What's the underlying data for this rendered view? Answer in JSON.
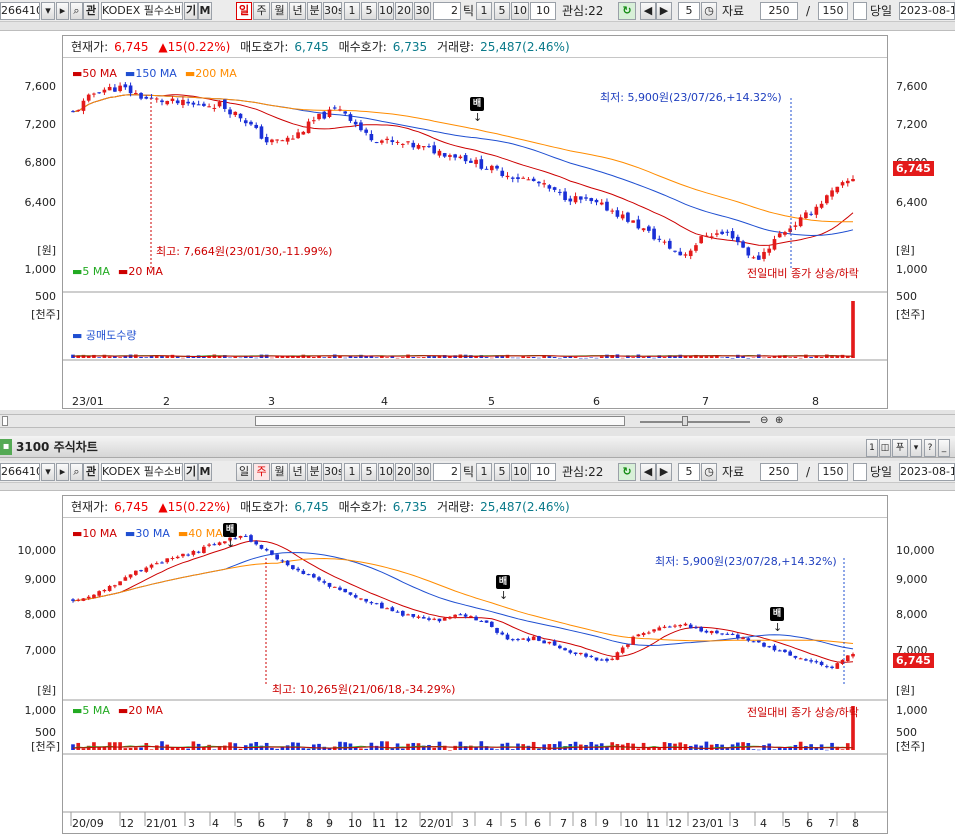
{
  "toolbar": {
    "code": "266410",
    "name": "KODEX 필수소비",
    "btn_gi": "기",
    "btn_m": "M",
    "periods": [
      "일",
      "주",
      "월",
      "년",
      "분",
      "30s",
      "1",
      "5",
      "10",
      "20",
      "30"
    ],
    "tick_value": "2",
    "tick_label": "틱",
    "ticks": [
      "1",
      "5",
      "10"
    ],
    "tick_input": "10",
    "watch_label": "관심:22",
    "count_input": "5",
    "data_label": "자료",
    "data_value": "250",
    "slash": "/",
    "max_value": "150",
    "today_label": "당일",
    "date": "2023-08-1"
  },
  "info": {
    "current_label": "현재가:",
    "current_value": "6,745",
    "change": "▲15(0.22%)",
    "ask_label": "매도호가:",
    "ask_value": "6,745",
    "bid_label": "매수호가:",
    "bid_value": "6,735",
    "vol_label": "거래량:",
    "vol_value": "25,487(2.46%)"
  },
  "chart1": {
    "legend": [
      {
        "label": "50 MA",
        "color": "#cc0000"
      },
      {
        "label": "150 MA",
        "color": "#1f4fd1"
      },
      {
        "label": "200 MA",
        "color": "#ff8c00"
      }
    ],
    "price_ticks": [
      "7,600",
      "7,200",
      "6,800",
      "6,400"
    ],
    "unit_left": "[원]",
    "unit_right": "[원]",
    "current_box": "6,745",
    "low_note": "최저: 5,900원(23/07/26,+14.32%)",
    "high_note": "최고: 7,664원(23/01/30,-11.99%)",
    "signal": "배",
    "vol_legend": [
      {
        "label": "5 MA",
        "color": "#22aa22"
      },
      {
        "label": "20 MA",
        "color": "#cc0000"
      }
    ],
    "vol_note": "전일대비 종가 상승/하락",
    "vol_ticks": [
      "1,000",
      "500"
    ],
    "vol_unit": "[천주]",
    "short_legend": "공매도수량",
    "x_labels": [
      "23/01",
      "2",
      "3",
      "4",
      "5",
      "6",
      "7",
      "8"
    ]
  },
  "chart2_title": "3100 주식차트",
  "chart2": {
    "legend": [
      {
        "label": "10 MA",
        "color": "#cc0000"
      },
      {
        "label": "30 MA",
        "color": "#1f4fd1"
      },
      {
        "label": "40 MA",
        "color": "#ff8c00"
      }
    ],
    "price_ticks": [
      "10,000",
      "9,000",
      "8,000",
      "7,000"
    ],
    "unit_left": "[원]",
    "unit_right": "[원]",
    "current_box": "6,745",
    "low_note": "최저: 5,900원(23/07/28,+14.32%)",
    "high_note": "최고: 10,265원(21/06/18,-34.29%)",
    "signal": "배",
    "vol_legend": [
      {
        "label": "5 MA",
        "color": "#22aa22"
      },
      {
        "label": "20 MA",
        "color": "#cc0000"
      }
    ],
    "vol_note": "전일대비 종가 상승/하락",
    "vol_ticks": [
      "1,000",
      "500"
    ],
    "vol_unit": "[천주]",
    "x_labels": [
      "20/09",
      "12",
      "21/01",
      "3",
      "4",
      "5",
      "6",
      "7",
      "8",
      "9",
      "10",
      "11",
      "12",
      "22/01",
      "3",
      "4",
      "5",
      "6",
      "7",
      "8",
      "9",
      "10",
      "11",
      "12",
      "23/01",
      "3",
      "4",
      "5",
      "6",
      "7",
      "8"
    ]
  },
  "colors": {
    "up": "#e31a1a",
    "down": "#1a2fd6"
  }
}
